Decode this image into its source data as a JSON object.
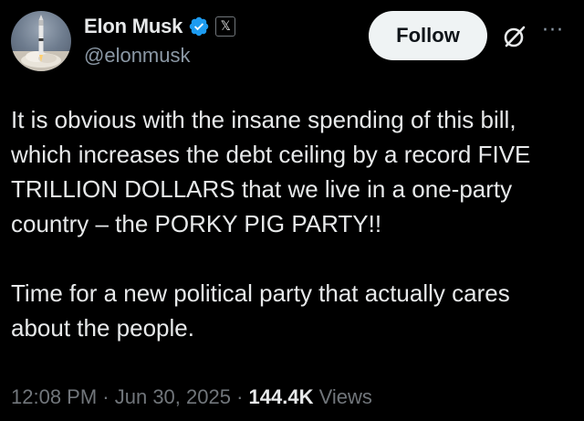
{
  "author": {
    "display_name": "Elon Musk",
    "handle": "@elonmusk",
    "verified": true,
    "affiliation_badge": "𝕏"
  },
  "actions": {
    "follow_label": "Follow",
    "grok_icon": "grok-icon",
    "more_icon_glyph": "···"
  },
  "tweet": {
    "paragraphs": [
      "It is obvious with the insane spending of this bill, which increases the debt ceiling by a record FIVE TRILLION DOLLARS that we live in a one-party country – the PORKY PIG PARTY!!",
      "Time for a new political party that actually cares about the people."
    ]
  },
  "meta": {
    "time": "12:08 PM",
    "sep1": " · ",
    "date": "Jun 30, 2025",
    "sep2": " · ",
    "views_count": "144.4K",
    "views_label": " Views"
  },
  "colors": {
    "background": "#000000",
    "text": "#e7e9ea",
    "muted": "#71767b",
    "verified_blue": "#1d9bf0",
    "follow_bg": "#eff3f4"
  }
}
